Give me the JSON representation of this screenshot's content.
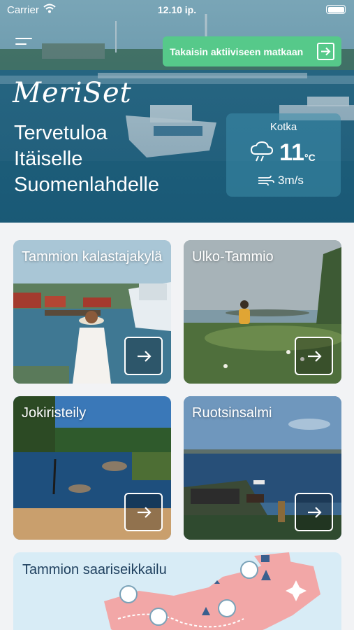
{
  "status_bar": {
    "carrier": "Carrier",
    "time": "12.10 ip."
  },
  "header": {
    "back_button_label": "Takaisin aktiiviseen matkaan",
    "logo_text": "MeriSet",
    "welcome_line1": "Tervetuloa",
    "welcome_line2": "Itäiselle",
    "welcome_line3": "Suomenlahdelle"
  },
  "weather": {
    "city": "Kotka",
    "temperature": "11",
    "unit": "°C",
    "wind": "3m/s",
    "icon": "cloud-rain-icon"
  },
  "destinations": [
    {
      "title": "Tammion kalastajakylä"
    },
    {
      "title": "Ulko-Tammio"
    },
    {
      "title": "Jokiristeily"
    },
    {
      "title": "Ruotsinsalmi"
    }
  ],
  "map_card": {
    "title": "Tammion saariseikkailu"
  },
  "colors": {
    "accent_green": "#56c98a",
    "background": "#f2f3f5",
    "map_title": "#1e3f5e"
  }
}
